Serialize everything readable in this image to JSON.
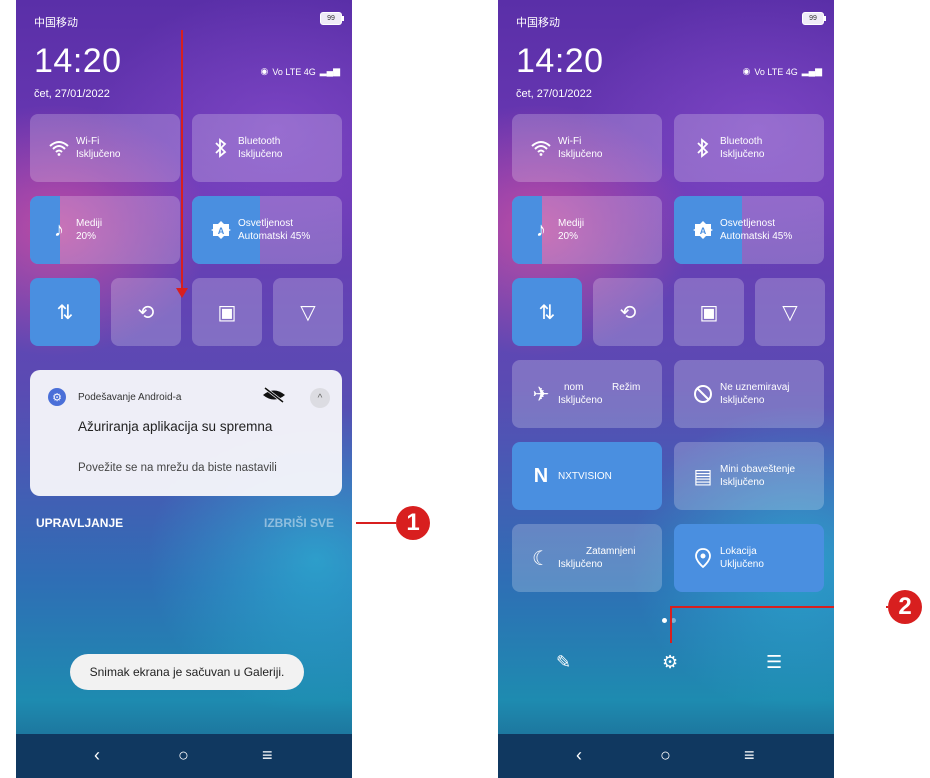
{
  "status": {
    "carrier": "中国移动",
    "battery": "99",
    "time": "14:20",
    "date": "čet, 27/01/2022",
    "network": "Vo LTE 4G"
  },
  "tiles": {
    "wifi": {
      "title": "Wi-Fi",
      "state": "Isključeno"
    },
    "bluetooth": {
      "title": "Bluetooth",
      "state": "Isključeno"
    },
    "media": {
      "title": "Mediji",
      "value": "20%",
      "level_percent": 20
    },
    "brightness": {
      "title": "Osvetljenost",
      "value": "Automatski 45%",
      "level_percent": 45
    },
    "airplane": {
      "title_a": "nom",
      "title_b": "Režim",
      "state": "Isključeno"
    },
    "dnd": {
      "title": "Ne uznemiravaj",
      "state": "Isključeno"
    },
    "nxt": {
      "title": "NXTVISION"
    },
    "mini": {
      "title": "Mini obaveštenje",
      "state": "Isključeno"
    },
    "dark": {
      "title": "Zatamnjeni",
      "state": "Isključeno"
    },
    "location": {
      "title": "Lokacija",
      "state": "Uključeno"
    }
  },
  "notification": {
    "app": "Podešavanje Android-a",
    "title": "Ažuriranja aplikacija su spremna",
    "subtitle": "Povežite se na mrežu da biste nastavili"
  },
  "actions": {
    "manage": "UPRAVLJANJE",
    "clear_all": "IZBRIŠI SVE"
  },
  "toast": "Snimak ekrana je sačuvan u Galeriji.",
  "callouts": {
    "one": "1",
    "two": "2"
  },
  "colors": {
    "accent": "#4a8fe0",
    "callout": "#d81f1f"
  },
  "icons": [
    "wifi-icon",
    "bluetooth-icon",
    "music-note-icon",
    "brightness-auto-icon",
    "data-arrows-icon",
    "rotate-icon",
    "screenshot-icon",
    "flashlight-icon",
    "airplane-icon",
    "dnd-icon",
    "nxtvision-icon",
    "mini-notification-icon",
    "dark-mode-icon",
    "location-icon",
    "edit-icon",
    "settings-gear-icon",
    "notification-history-icon",
    "back-icon",
    "home-icon",
    "recents-icon"
  ]
}
